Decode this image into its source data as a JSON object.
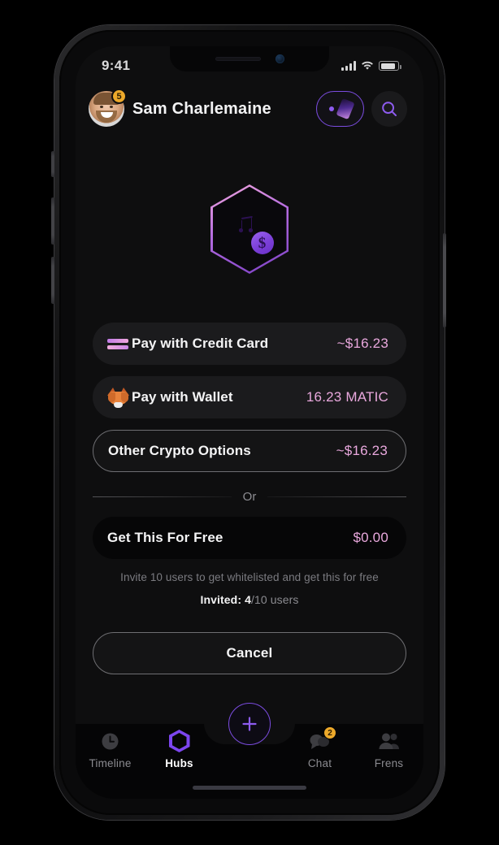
{
  "status_bar": {
    "time": "9:41",
    "signal_icon": "cellular-signal-icon",
    "wifi_icon": "wifi-icon",
    "battery_icon": "battery-icon"
  },
  "header": {
    "user_name": "Sam Charlemaine",
    "avatar_badge_count": "5",
    "avatar_icon": "avatar",
    "nft_button_icon": "nft-card-icon",
    "search_button_icon": "search-icon"
  },
  "hero": {
    "badge_icon": "hexagon-ticket-badge-icon",
    "coin_symbol": "$"
  },
  "options": [
    {
      "id": "pay-credit-card",
      "label": "Pay with Credit Card",
      "price": "~$16.23",
      "icon": "credit-card-icon",
      "style": "filled"
    },
    {
      "id": "pay-wallet",
      "label": "Pay with Wallet",
      "price": "16.23 MATIC",
      "icon": "metamask-fox-icon",
      "style": "filled"
    },
    {
      "id": "other-crypto-options",
      "label": "Other Crypto Options",
      "price": "~$16.23",
      "icon": "none",
      "style": "outlined"
    }
  ],
  "divider": {
    "text": "Or"
  },
  "free_option": {
    "label": "Get This For Free",
    "price": "$0.00",
    "note": "Invite 10 users to get whitelisted and get this for free",
    "invited_label": "Invited: 4",
    "invited_rest": "/10 users"
  },
  "cancel": {
    "label": "Cancel"
  },
  "fab": {
    "icon": "plus-icon"
  },
  "nav": {
    "items": [
      {
        "id": "timeline",
        "label": "Timeline",
        "icon": "clock-icon",
        "active": false,
        "badge": ""
      },
      {
        "id": "hubs",
        "label": "Hubs",
        "icon": "hexagon-icon",
        "active": true,
        "badge": ""
      },
      {
        "id": "chat",
        "label": "Chat",
        "icon": "chat-bubble-icon",
        "active": false,
        "badge": "2"
      },
      {
        "id": "frens",
        "label": "Frens",
        "icon": "people-icon",
        "active": false,
        "badge": ""
      }
    ]
  },
  "colors": {
    "accent_purple": "#7c46ef",
    "accent_pink": "#e9a8dd",
    "badge_amber": "#eda92a",
    "screen_bg": "#0e0e0f"
  }
}
